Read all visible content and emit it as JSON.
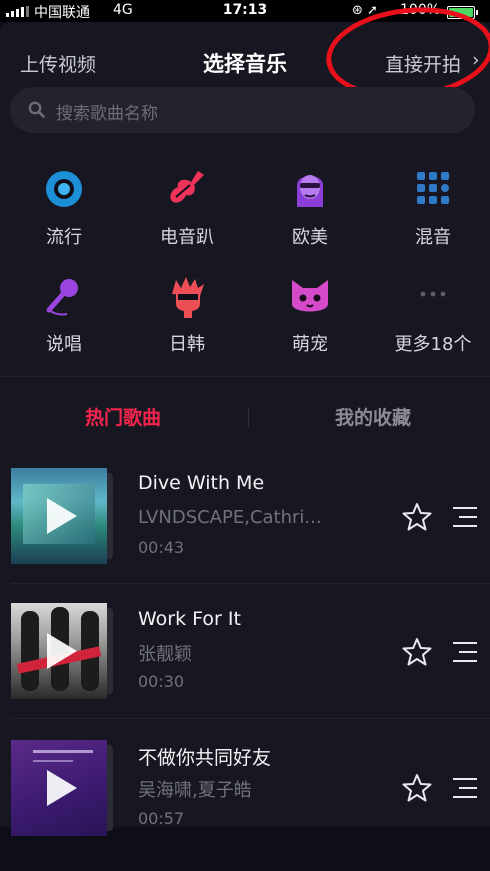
{
  "status_bar": {
    "carrier": "中国联通",
    "network": "4G",
    "time": "17:13",
    "battery_percent": "100%"
  },
  "header": {
    "upload_label": "上传视频",
    "title": "选择音乐",
    "direct_shoot_label": "直接开拍",
    "chevron": "›"
  },
  "search": {
    "placeholder": "搜索歌曲名称"
  },
  "categories": [
    {
      "label": "流行",
      "icon": "vinyl-disc-icon"
    },
    {
      "label": "电音趴",
      "icon": "electric-guitar-icon"
    },
    {
      "label": "欧美",
      "icon": "woman-face-icon"
    },
    {
      "label": "混音",
      "icon": "dot-grid-icon"
    },
    {
      "label": "说唱",
      "icon": "microphone-icon"
    },
    {
      "label": "日韩",
      "icon": "spiky-hair-face-icon"
    },
    {
      "label": "萌宠",
      "icon": "cat-face-icon"
    },
    {
      "label": "更多18个",
      "icon": "more-dots-icon"
    }
  ],
  "tabs": {
    "hot": "热门歌曲",
    "favorites": "我的收藏",
    "active": "hot",
    "active_color": "#f5254d"
  },
  "songs": [
    {
      "title": "Dive With Me",
      "artist": "LVNDSCAPE,Cathri...",
      "duration": "00:43"
    },
    {
      "title": "Work For It",
      "artist": "张靓颖",
      "duration": "00:30"
    },
    {
      "title": "不做你共同好友",
      "artist": "吴海啸,夏子皓",
      "duration": "00:57"
    }
  ],
  "colors": {
    "accent": "#f5254d",
    "background": "#161720",
    "annotation": "#e8101a"
  }
}
